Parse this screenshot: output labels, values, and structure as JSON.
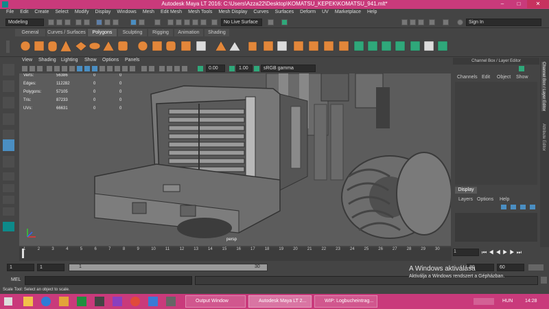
{
  "title_bar": {
    "title": "Autodesk Maya LT 2016: C:\\Users\\Azza22\\Desktop\\KOMATSU_KEPEK\\KOMATSU_941.mlt*",
    "min": "–",
    "max": "□",
    "close": "✕"
  },
  "menu": [
    "File",
    "Edit",
    "Create",
    "Select",
    "Modify",
    "Display",
    "Windows",
    "Mesh",
    "Edit Mesh",
    "Mesh Tools",
    "Mesh Display",
    "Curves",
    "Surfaces",
    "Deform",
    "UV",
    "Marketplace",
    "Help"
  ],
  "status_line": {
    "mode": "Modeling",
    "live_surface": "No Live Surface",
    "sign_in": "Sign In"
  },
  "shelf_tabs": [
    "General",
    "Curves / Surfaces",
    "Polygons",
    "Sculpting",
    "Rigging",
    "Animation",
    "Shading"
  ],
  "shelf_active": "Polygons",
  "viewport": {
    "menu": [
      "View",
      "Shading",
      "Lighting",
      "Show",
      "Options",
      "Panels"
    ],
    "exposure": "0.00",
    "gamma": "1.00",
    "color_space": "sRGB gamma",
    "camera": "persp",
    "hud": [
      {
        "label": "Verts:",
        "v1": "56386",
        "v2": "0",
        "v3": "0"
      },
      {
        "label": "Edges:",
        "v1": "112282",
        "v2": "0",
        "v3": "0"
      },
      {
        "label": "Polygons:",
        "v1": "57105",
        "v2": "0",
        "v3": "0"
      },
      {
        "label": "Tris:",
        "v1": "87233",
        "v2": "0",
        "v3": "0"
      },
      {
        "label": "UVs:",
        "v1": "66631",
        "v2": "0",
        "v3": "0"
      }
    ]
  },
  "channel_box": {
    "title": "Channel Box / Layer Editor",
    "menu": [
      "Channels",
      "Edit",
      "Object",
      "Show"
    ],
    "display_tab": "Display",
    "layer_menu": [
      "Layers",
      "Options",
      "Help"
    ],
    "side_tabs": [
      "Channel Box / Layer Editor",
      "Attribute Editor"
    ]
  },
  "timeline": {
    "ticks": [
      "1",
      "2",
      "3",
      "4",
      "5",
      "6",
      "7",
      "8",
      "9",
      "10",
      "11",
      "12",
      "13",
      "14",
      "15",
      "16",
      "17",
      "18",
      "19",
      "20",
      "21",
      "22",
      "23",
      "24",
      "25",
      "26",
      "27",
      "28",
      "29",
      "30"
    ],
    "current": "1"
  },
  "range": {
    "start": "1",
    "start_inner": "1",
    "slider_start": "1",
    "slider_end": "30",
    "end_inner": "30",
    "end": "60"
  },
  "command": {
    "label": "MEL"
  },
  "help_line": "Scale Tool: Select an object to scale.",
  "windows_activation": {
    "line1": "A Windows aktiválása",
    "line2": "Aktiválja a Windows rendszert a Gépházban."
  },
  "taskbar": {
    "apps": [
      "Output Window",
      "Autodesk Maya LT 2...",
      "WIP: Logbucheintrag..."
    ],
    "language": "HUN",
    "time": "14:28"
  },
  "colors": {
    "title": "#c93a7b",
    "shelf_orange": "#e3873a",
    "shelf_green": "#2fa87a",
    "selection_blue": "#4a8ec2"
  }
}
